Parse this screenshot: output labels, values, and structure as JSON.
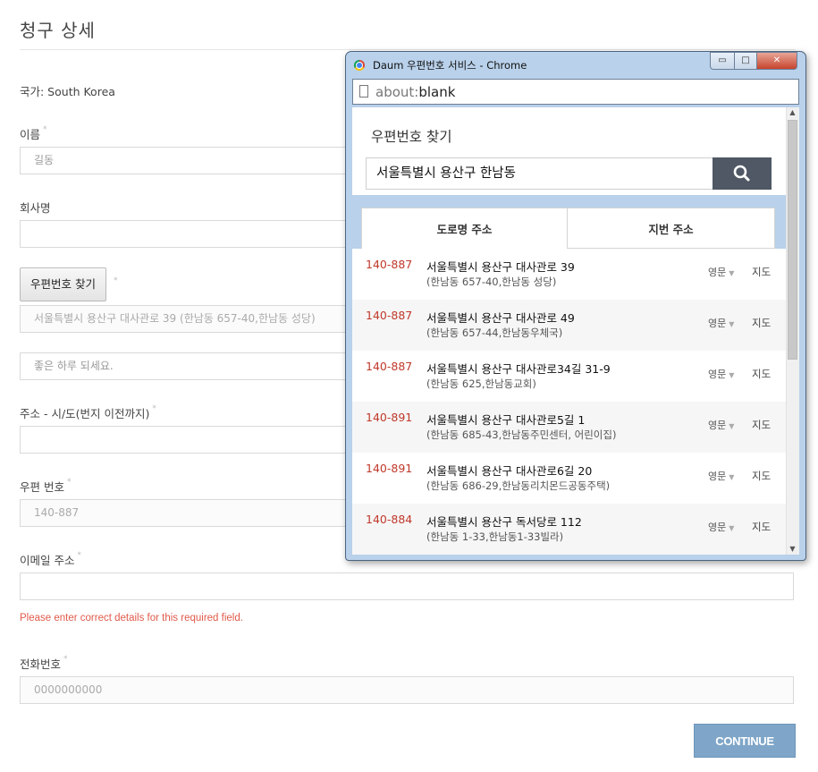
{
  "page": {
    "title": "청구 상세",
    "country": "국가: South Korea",
    "name_label": "이름",
    "name_value": "길동",
    "company_label": "회사명",
    "company_value": "",
    "postcode_button": "우편번호 찾기",
    "address1_value": "서울특별시 용산구 대사관로 39 (한남동 657-40,한남동 성당)",
    "address2_placeholder": "좋은 하루 되세요.",
    "city_label": "주소 - 시/도(번지 이전까지)",
    "city_value": "",
    "postal_label": "우편 번호",
    "postal_value": "140-887",
    "email_label": "이메일 주소",
    "email_value": "",
    "error_text": "Please enter correct details for this required field.",
    "phone_label": "전화번호",
    "phone_value": "0000000000",
    "required_mark": "*",
    "continue_label": "CONTINUE"
  },
  "popup": {
    "window_title": "Daum 우편번호 서비스 - Chrome",
    "url_prefix": "about:",
    "url_main": "blank",
    "search_title": "우편번호 찾기",
    "search_value": "서울특별시 용산구 한남동",
    "tabs": [
      "도로명 주소",
      "지번 주소"
    ],
    "results": [
      {
        "zip": "140-887",
        "address": "서울특별시 용산구 대사관로 39",
        "sub": "(한남동 657-40,한남동 성당)",
        "eng": "영문",
        "map": "지도"
      },
      {
        "zip": "140-887",
        "address": "서울특별시 용산구 대사관로 49",
        "sub": "(한남동 657-44,한남동우체국)",
        "eng": "영문",
        "map": "지도"
      },
      {
        "zip": "140-887",
        "address": "서울특별시 용산구 대사관로34길 31-9",
        "sub": "(한남동 625,한남동교회)",
        "eng": "영문",
        "map": "지도"
      },
      {
        "zip": "140-891",
        "address": "서울특별시 용산구 대사관로5길 1",
        "sub": "(한남동 685-43,한남동주민센터, 어린이집)",
        "eng": "영문",
        "map": "지도"
      },
      {
        "zip": "140-891",
        "address": "서울특별시 용산구 대사관로6길 20",
        "sub": "(한남동 686-29,한남동리치몬드공동주택)",
        "eng": "영문",
        "map": "지도"
      },
      {
        "zip": "140-884",
        "address": "서울특별시 용산구 독서당로 112",
        "sub": "(한남동 1-33,한남동1-33빌라)",
        "eng": "영문",
        "map": "지도"
      }
    ]
  },
  "colors": {
    "continue_bg": "#7fa6c8",
    "error": "#e05a4a",
    "zip": "#c0392b",
    "search_button": "#4f5864"
  }
}
